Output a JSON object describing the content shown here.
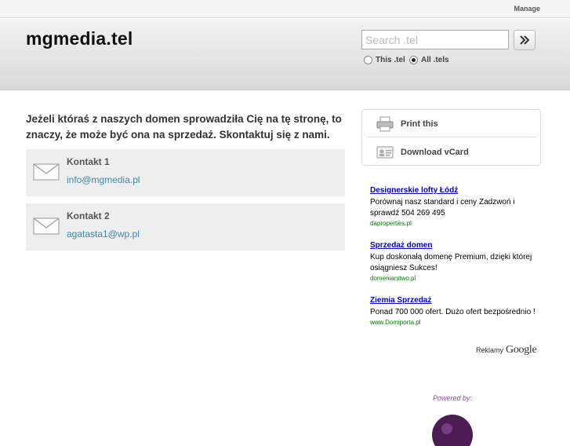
{
  "topbar": {
    "manage_label": "Manage"
  },
  "header": {
    "site_title": "mgmedia.tel",
    "search_placeholder": "Search .tel",
    "search_icon": "double-chevron-right-icon",
    "scope_options": [
      {
        "label": "This .tel",
        "checked": false
      },
      {
        "label": "All .tels",
        "checked": true
      }
    ]
  },
  "main": {
    "intro": "Jeżeli któraś z naszych domen sprowadziła Cię na tę stronę, to znaczy, że może być ona na sprzedaż. Skontaktuj się z nami.",
    "contacts": [
      {
        "label": "Kontakt 1",
        "email": "info@mgmedia.pl",
        "icon": "envelope-icon"
      },
      {
        "label": "Kontakt 2",
        "email": "agatasta1@wp.pl",
        "icon": "envelope-icon"
      }
    ]
  },
  "panel": {
    "print_label": "Print this",
    "print_icon": "printer-icon",
    "vcard_label": "Download vCard",
    "vcard_icon": "vcard-icon"
  },
  "ads": {
    "items": [
      {
        "title": "Designerskie lofty Łódź",
        "desc": "Porównaj nasz standard i ceny Zadzwoń i sprawdź 504 269 495",
        "url": "daproperties.pl"
      },
      {
        "title": "Sprzedaż domen",
        "desc": "Kup doskonałą domenę Premium, dzięki której osiągniesz Sukces!",
        "url": "domeniarstwo.pl"
      },
      {
        "title": "Ziemia Sprzedaż",
        "desc": "Ponad 700 000 ofert. Dużo ofert bezpośrednio !",
        "url": "www.Domiporta.pl"
      }
    ],
    "reklamy_label": "Reklamy",
    "google_label": "Google"
  },
  "footer": {
    "powered_by": "Powered by:"
  },
  "colors": {
    "accent_link": "#3d8aa8",
    "ad_title": "#0000cc",
    "ad_url": "#008000",
    "powered_by": "#9b3fa0"
  }
}
